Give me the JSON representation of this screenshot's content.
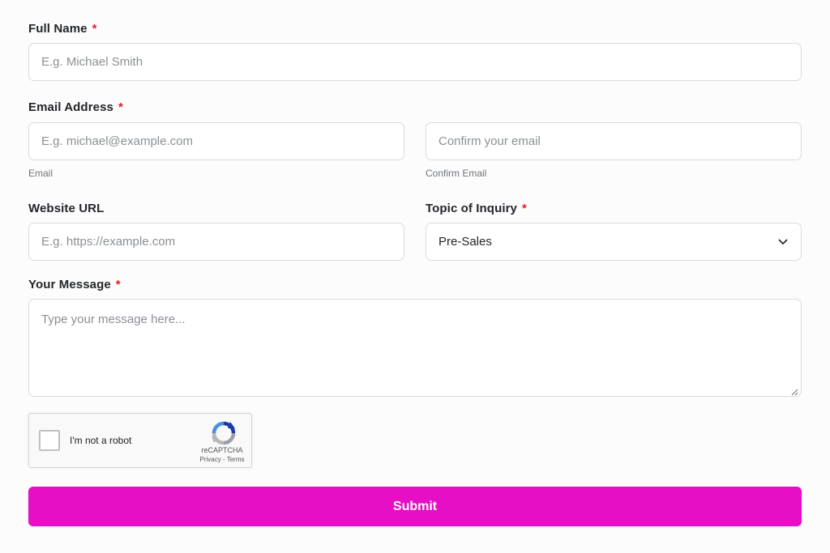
{
  "full_name": {
    "label": "Full Name",
    "required_mark": "*",
    "placeholder": "E.g. Michael Smith",
    "value": ""
  },
  "email": {
    "label": "Email Address",
    "required_mark": "*",
    "email_placeholder": "E.g. michael@example.com",
    "email_value": "",
    "email_helper": "Email",
    "confirm_placeholder": "Confirm your email",
    "confirm_value": "",
    "confirm_helper": "Confirm Email"
  },
  "website": {
    "label": "Website URL",
    "placeholder": "E.g. https://example.com",
    "value": ""
  },
  "topic": {
    "label": "Topic of Inquiry",
    "required_mark": "*",
    "selected": "Pre-Sales",
    "icon": "chevron-down-icon"
  },
  "message": {
    "label": "Your Message",
    "required_mark": "*",
    "placeholder": "Type your message here...",
    "value": ""
  },
  "recaptcha": {
    "label": "I'm not a robot",
    "brand": "reCAPTCHA",
    "privacy": "Privacy",
    "separator": " - ",
    "terms": "Terms",
    "icon": "recaptcha-logo-icon"
  },
  "submit": {
    "label": "Submit"
  },
  "colors": {
    "accent": "#e60fc6",
    "required": "#d92323",
    "border": "#d9dbe0",
    "background": "#fcfcfd"
  }
}
